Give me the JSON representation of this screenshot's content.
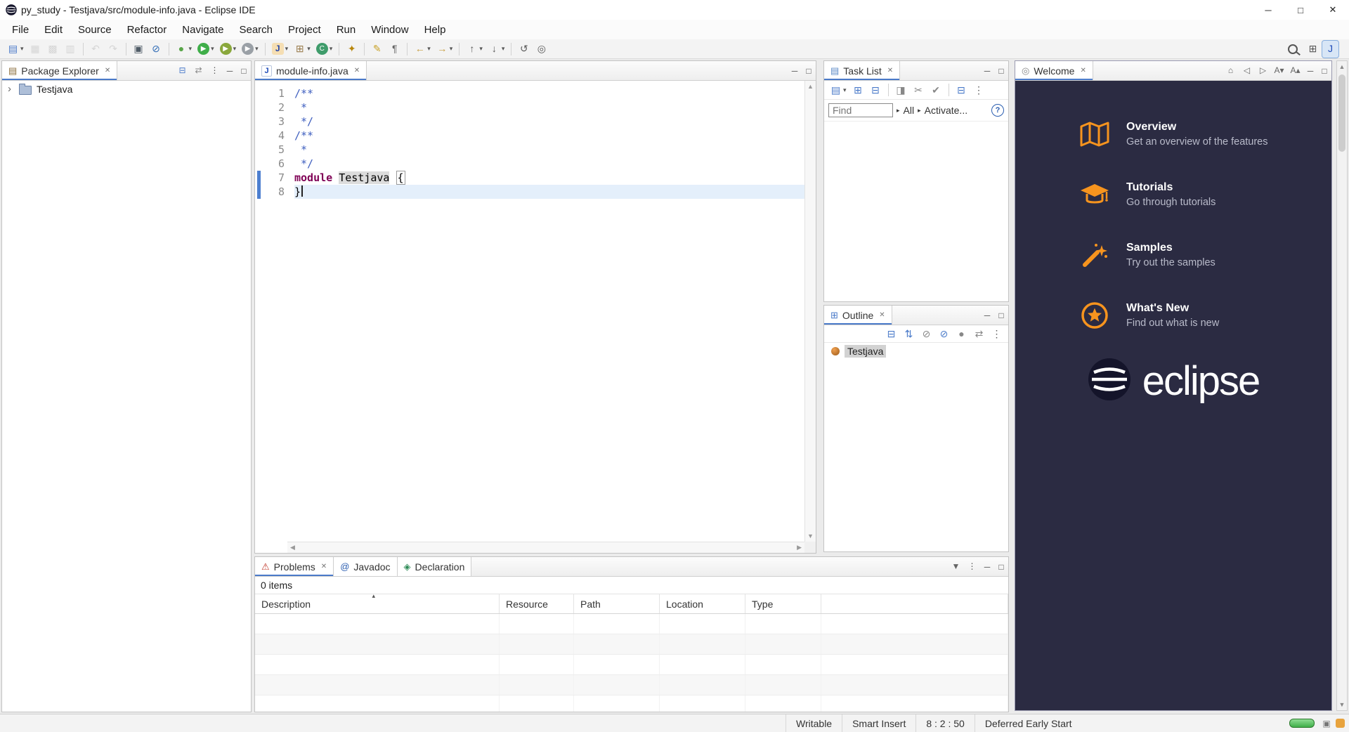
{
  "window": {
    "title": "py_study - Testjava/src/module-info.java - Eclipse IDE"
  },
  "glyphs": {
    "close": "✕",
    "minimize": "─",
    "maximize": "□",
    "dropdown": "▾",
    "arrow_right": "▸",
    "scroll_up": "▲",
    "scroll_down": "▼",
    "scroll_left": "◀",
    "scroll_right": "▶",
    "sort_caret": "▴",
    "tree_collapsed": "›",
    "menu_overflow": "⋮"
  },
  "colors": {
    "welcome_bg": "#2b2b42",
    "welcome_accent": "#f7941e",
    "welcome_subtext": "#b9bbca",
    "keyword": "#7f0055",
    "comment": "#3f5fbf",
    "current_line_bg": "#e4effb",
    "occurrence_bg": "#dcdcdc",
    "tab_accent": "#4a7ac9",
    "range_indicator": "#4d7fd0",
    "progress_green": "#3fae49",
    "notification_orange": "#e8a33d"
  },
  "menubar": {
    "items": [
      "File",
      "Edit",
      "Source",
      "Refactor",
      "Navigate",
      "Search",
      "Project",
      "Run",
      "Window",
      "Help"
    ]
  },
  "toolbar": {
    "left_items": [
      {
        "name": "new-wizard",
        "glyph": "▤",
        "color": "#4a7ac9",
        "dd": 1
      },
      {
        "name": "save",
        "glyph": "▦",
        "color": "#a6a6a6",
        "dis": 1
      },
      {
        "name": "save-all",
        "glyph": "▩",
        "color": "#a6a6a6",
        "dis": 1
      },
      {
        "name": "print",
        "glyph": "▥",
        "color": "#a6a6a6",
        "dis": 1
      },
      {
        "sep": 1
      },
      {
        "name": "undo",
        "glyph": "↶",
        "color": "#a6a6a6",
        "dis": 1
      },
      {
        "name": "redo",
        "glyph": "↷",
        "color": "#a6a6a6",
        "dis": 1
      },
      {
        "sep": 1
      },
      {
        "name": "open-console",
        "glyph": "▣",
        "color": "#4f5b66"
      },
      {
        "name": "skip-all-breakpoints",
        "glyph": "⊘",
        "color": "#2f6bb5"
      },
      {
        "sep": 1
      },
      {
        "name": "debug",
        "glyph": "●",
        "color": "#58a548",
        "dd": 1
      },
      {
        "name": "run",
        "glyph": "▶",
        "bg": "#3fae49",
        "color": "#ffffff",
        "shape": "circle",
        "dd": 1
      },
      {
        "name": "coverage",
        "glyph": "▶",
        "bg": "#8aa83c",
        "color": "#ffffff",
        "shape": "circle",
        "dd": 1
      },
      {
        "name": "run-external-tools",
        "glyph": "▶",
        "bg": "#9aa0a6",
        "color": "#ffffff",
        "shape": "circle",
        "dd": 1
      },
      {
        "sep": 1
      },
      {
        "name": "new-java-project",
        "glyph": "J",
        "bg": "#f5deb3",
        "color": "#2545a8",
        "shape": "square",
        "dd": 1
      },
      {
        "name": "new-java-package",
        "glyph": "⊞",
        "color": "#9a7d4e",
        "dd": 1
      },
      {
        "name": "new-java-class",
        "glyph": "C",
        "bg": "#3f9c6b",
        "color": "#ffffff",
        "shape": "circle",
        "dd": 1
      },
      {
        "sep": 1
      },
      {
        "name": "open-search-dialog",
        "glyph": "✦",
        "color": "#b8860b"
      },
      {
        "sep": 1
      },
      {
        "name": "toggle-mark-occurrences",
        "glyph": "✎",
        "color": "#c9a227"
      },
      {
        "name": "show-whitespace-characters",
        "glyph": "¶",
        "color": "#666666"
      },
      {
        "sep": 1
      },
      {
        "name": "back",
        "glyph": "←",
        "color": "#c79c3c",
        "dd": 1
      },
      {
        "name": "forward",
        "glyph": "→",
        "color": "#c79c3c",
        "dd": 1
      },
      {
        "sep": 1
      },
      {
        "name": "previous-annotation",
        "glyph": "↑",
        "color": "#5a5a5a",
        "dd": 1
      },
      {
        "name": "next-annotation",
        "glyph": "↓",
        "color": "#5a5a5a",
        "dd": 1
      },
      {
        "sep": 1
      },
      {
        "name": "last-edit-location",
        "glyph": "↺",
        "color": "#5a5a5a"
      },
      {
        "name": "pin-editor",
        "glyph": "◎",
        "color": "#5a5a5a"
      }
    ],
    "right_items": [
      {
        "name": "quick-access-search",
        "shape": "mag"
      },
      {
        "name": "open-perspective",
        "glyph": "⊞",
        "color": "#555555"
      },
      {
        "name": "java-perspective",
        "glyph": "J",
        "color": "#1e4bb8",
        "active": 1
      }
    ]
  },
  "package_explorer": {
    "title": "Package Explorer",
    "tab_icon": "▤",
    "toolbar_icons": [
      {
        "name": "collapse-all",
        "glyph": "⊟",
        "color": "#4a7ac9"
      },
      {
        "name": "link-with-editor",
        "glyph": "⇄",
        "color": "#888888"
      },
      {
        "name": "view-menu",
        "glyph": "⋮",
        "color": "#555555"
      }
    ],
    "tree": [
      {
        "label": "Testjava"
      }
    ]
  },
  "editor": {
    "tab": {
      "label": "module-info.java",
      "icon": "J"
    },
    "lines": [
      {
        "n": "1",
        "tokens": [
          [
            "doc",
            "/**"
          ]
        ]
      },
      {
        "n": "2",
        "tokens": [
          [
            "doc",
            " *"
          ]
        ]
      },
      {
        "n": "3",
        "tokens": [
          [
            "doc",
            " */"
          ]
        ]
      },
      {
        "n": "4",
        "tokens": [
          [
            "doc",
            "/**"
          ]
        ]
      },
      {
        "n": "5",
        "tokens": [
          [
            "doc",
            " *"
          ]
        ]
      },
      {
        "n": "6",
        "tokens": [
          [
            "doc",
            " */"
          ]
        ]
      },
      {
        "n": "7",
        "tokens": [
          [
            "kw",
            "module"
          ],
          [
            "plain",
            " "
          ],
          [
            "occ",
            "Testjava"
          ],
          [
            "plain",
            " "
          ],
          [
            "bracket",
            "{"
          ]
        ]
      },
      {
        "n": "8",
        "tokens": [
          [
            "plain",
            "}"
          ]
        ],
        "current": true
      }
    ]
  },
  "tasklist": {
    "title": "Task List",
    "tab_icon": "▤",
    "toolbar_icons": [
      {
        "name": "new-task",
        "glyph": "▤",
        "color": "#4a7ac9",
        "dd": 1
      },
      {
        "name": "categorized-presentation",
        "glyph": "⊞",
        "color": "#4a7ac9"
      },
      {
        "name": "scheduled-presentation",
        "glyph": "⊟",
        "color": "#4a7ac9"
      },
      {
        "sep": 1
      },
      {
        "name": "focus-on-workweek",
        "glyph": "◨",
        "color": "#888888"
      },
      {
        "name": "cut",
        "glyph": "✂",
        "color": "#888888"
      },
      {
        "name": "mark-task-complete",
        "glyph": "✔",
        "color": "#888888"
      },
      {
        "sep": 1
      },
      {
        "name": "collapse-all",
        "glyph": "⊟",
        "color": "#4a7ac9"
      },
      {
        "name": "view-menu",
        "glyph": "⋮",
        "color": "#555555"
      }
    ],
    "find": {
      "placeholder": "Find",
      "all_label": "All",
      "activate_label": "Activate...",
      "help_glyph": "?"
    }
  },
  "outline": {
    "title": "Outline",
    "toolbar_icons": [
      {
        "name": "collapse-all",
        "glyph": "⊟",
        "color": "#4a7ac9"
      },
      {
        "name": "sort",
        "glyph": "⇅",
        "color": "#4a7ac9"
      },
      {
        "name": "hide-fields",
        "glyph": "⊘",
        "color": "#888888"
      },
      {
        "name": "hide-static-members",
        "glyph": "⊘",
        "color": "#4a7ac9"
      },
      {
        "name": "hide-non-public-members",
        "glyph": "●",
        "color": "#888888"
      },
      {
        "name": "link-with-editor",
        "glyph": "⇄",
        "color": "#888888"
      },
      {
        "name": "view-menu",
        "glyph": "⋮",
        "color": "#555555"
      }
    ],
    "items": [
      {
        "label": "Testjava"
      }
    ]
  },
  "problems": {
    "tabs": [
      {
        "label": "Problems",
        "icon": "⚠",
        "icon_color": "#c0392b",
        "selected": true
      },
      {
        "label": "Javadoc",
        "icon": "@",
        "icon_color": "#2a5db0"
      },
      {
        "label": "Declaration",
        "icon": "◈",
        "icon_color": "#2e8b57"
      }
    ],
    "header_icons": [
      {
        "name": "filter",
        "glyph": "▼",
        "color": "#666666"
      },
      {
        "name": "view-menu",
        "glyph": "⋮",
        "color": "#555555"
      }
    ],
    "summary": "0 items",
    "columns": [
      "Description",
      "Resource",
      "Path",
      "Location",
      "Type"
    ],
    "rows": []
  },
  "welcome": {
    "title": "Welcome",
    "tab_icon": "◎",
    "header_icons": [
      {
        "name": "home",
        "glyph": "⌂",
        "color": "#666666"
      },
      {
        "name": "nav-back",
        "glyph": "◁",
        "color": "#666666"
      },
      {
        "name": "nav-forward",
        "glyph": "▷",
        "color": "#666666"
      },
      {
        "name": "decrease-text",
        "glyph": "A▾",
        "color": "#666666"
      },
      {
        "name": "increase-text",
        "glyph": "A▴",
        "color": "#666666"
      }
    ],
    "items": [
      {
        "icon": "overview",
        "title": "Overview",
        "subtitle": "Get an overview of the features"
      },
      {
        "icon": "tutorials",
        "title": "Tutorials",
        "subtitle": "Go through tutorials"
      },
      {
        "icon": "samples",
        "title": "Samples",
        "subtitle": "Try out the samples"
      },
      {
        "icon": "whatsnew",
        "title": "What's New",
        "subtitle": "Find out what is new"
      }
    ],
    "logo_text": "eclipse"
  },
  "statusbar": {
    "writable": "Writable",
    "input_mode": "Smart Insert",
    "caret_position": "8 : 2 : 50",
    "status_message": "Deferred Early Start"
  }
}
